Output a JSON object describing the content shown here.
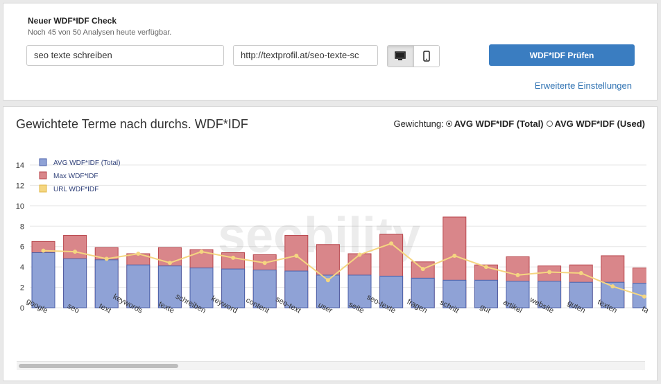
{
  "check": {
    "title": "Neuer WDF*IDF Check",
    "subtitle": "Noch 45 von 50 Analysen heute verfügbar.",
    "keyword_value": "seo texte schreiben",
    "url_value": "http://textprofil.at/seo-texte-sc",
    "device_options": [
      "desktop-icon",
      "mobile-icon"
    ],
    "device_selected": "desktop",
    "submit_label": "WDF*IDF Prüfen",
    "advanced_link": "Erweiterte Einstellungen"
  },
  "chart_section": {
    "title": "Gewichtete Terme nach durchs. WDF*IDF",
    "weighting_label": "Gewichtung:",
    "options": [
      "AVG WDF*IDF (Total)",
      "AVG WDF*IDF (Used)"
    ],
    "selected": "AVG WDF*IDF (Total)",
    "watermark": "seobility"
  },
  "chart_data": {
    "type": "bar",
    "stacked": true,
    "categories": [
      "google",
      "seo",
      "text",
      "keywords",
      "texte",
      "schreiben",
      "keyword",
      "content",
      "seo-text",
      "user",
      "seite",
      "seo-texte",
      "fragen",
      "schritt",
      "gut",
      "artikel",
      "website",
      "guten",
      "texten",
      "ta"
    ],
    "series": [
      {
        "name": "AVG WDF*IDF (Total)",
        "type": "bar",
        "color": "#8fa2d6",
        "values": [
          5.4,
          4.8,
          4.7,
          4.2,
          4.1,
          3.9,
          3.8,
          3.7,
          3.6,
          3.2,
          3.2,
          3.1,
          2.9,
          2.7,
          2.7,
          2.6,
          2.6,
          2.5,
          2.5,
          2.4
        ]
      },
      {
        "name": "Max WDF*IDF",
        "type": "bar",
        "color": "#d9868a",
        "values": [
          6.5,
          7.1,
          5.9,
          5.3,
          5.9,
          5.7,
          5.4,
          5.2,
          7.1,
          6.2,
          5.3,
          7.2,
          4.5,
          8.9,
          4.2,
          5.0,
          4.1,
          4.2,
          5.1,
          3.9
        ]
      },
      {
        "name": "URL WDF*IDF",
        "type": "line",
        "color": "#f5d680",
        "values": [
          5.6,
          5.5,
          4.8,
          5.3,
          4.4,
          5.5,
          4.9,
          4.4,
          5.1,
          2.7,
          5.2,
          6.3,
          3.8,
          5.1,
          4.0,
          3.2,
          3.5,
          3.4,
          2.1,
          1.1
        ]
      }
    ],
    "ylim": [
      0,
      14
    ],
    "yticks": [
      0,
      2,
      4,
      6,
      8,
      10,
      12,
      14
    ],
    "grid": true,
    "legend_position": "top-left"
  }
}
